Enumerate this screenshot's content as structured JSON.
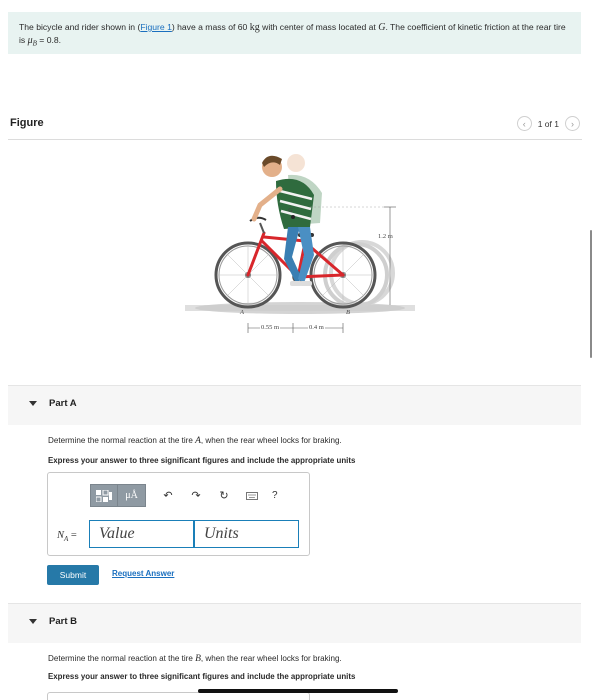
{
  "problem": {
    "text_before_link": "The bicycle and rider shown in (",
    "figure_link": "Figure 1",
    "text_after_link": ") have a mass of 60 ",
    "mass_unit": "kg",
    "text_mid": " with center of mass located at ",
    "com_symbol": "G",
    "text_end": ". The coefficient of kinetic friction at the rear tire is ",
    "mu_symbol": "μ",
    "mu_subscript": "B",
    "mu_value": " = 0.8."
  },
  "figure": {
    "title": "Figure",
    "pager_text": "1 of 1",
    "labels": {
      "height": "1.2 m",
      "dist_a": "0.55 m",
      "dist_b": "0.4 m",
      "point_a": "A",
      "point_b": "B",
      "point_g": "G"
    }
  },
  "part_a": {
    "label": "Part A",
    "question_before": "Determine the normal reaction at the tire ",
    "question_symbol": "A",
    "question_after": ", when the rear wheel locks for braking.",
    "instruction": "Express your answer to three significant figures and include the appropriate units",
    "toolbar": {
      "templates_icon": "templates-icon",
      "units_button": "μÅ",
      "help": "?"
    },
    "answer_label": "N",
    "answer_subscript": "A",
    "answer_equals": " =",
    "value_placeholder": "Value",
    "units_placeholder": "Units",
    "submit_label": "Submit",
    "request_answer_label": "Request Answer"
  },
  "part_b": {
    "label": "Part B",
    "question_before": "Determine the normal reaction at the tire ",
    "question_symbol": "B",
    "question_after": ", when the rear wheel locks for braking.",
    "instruction": "Express your answer to three significant figures and include the appropriate units"
  },
  "colors": {
    "problem_bg": "#e8f3f1",
    "link": "#1a6fbf",
    "submit_bg": "#2679a8",
    "field_border": "#1a7fb8",
    "bike_frame": "#d8262b"
  }
}
